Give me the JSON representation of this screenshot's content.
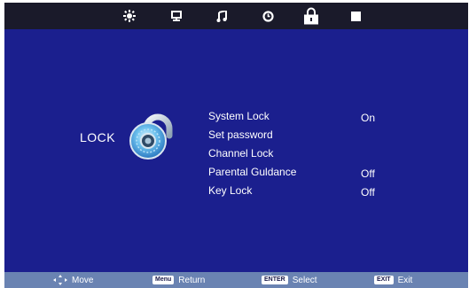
{
  "top_menu": {
    "icons": [
      "picture-icon",
      "monitor-icon",
      "music-note-icon",
      "timer-icon",
      "lock-icon",
      "stop-square-icon"
    ],
    "selected": "lock-icon"
  },
  "menu_title": "LOCK",
  "options": [
    {
      "label": "System Lock",
      "value": "On"
    },
    {
      "label": "Set password",
      "value": ""
    },
    {
      "label": "Channel Lock",
      "value": ""
    },
    {
      "label": "Parental Guldance",
      "value": "Off"
    },
    {
      "label": "Key Lock",
      "value": "Off"
    }
  ],
  "footer": {
    "move_label": "Move",
    "menu_key": "Menu",
    "menu_label": "Return",
    "enter_key": "ENTER",
    "enter_label": "Select",
    "exit_key": "EXIT",
    "exit_label": "Exit"
  },
  "colors": {
    "background": "#1b1f8e",
    "topbar": "#1a1a2a",
    "footer": "#6a83b2",
    "text": "#ffffff"
  }
}
